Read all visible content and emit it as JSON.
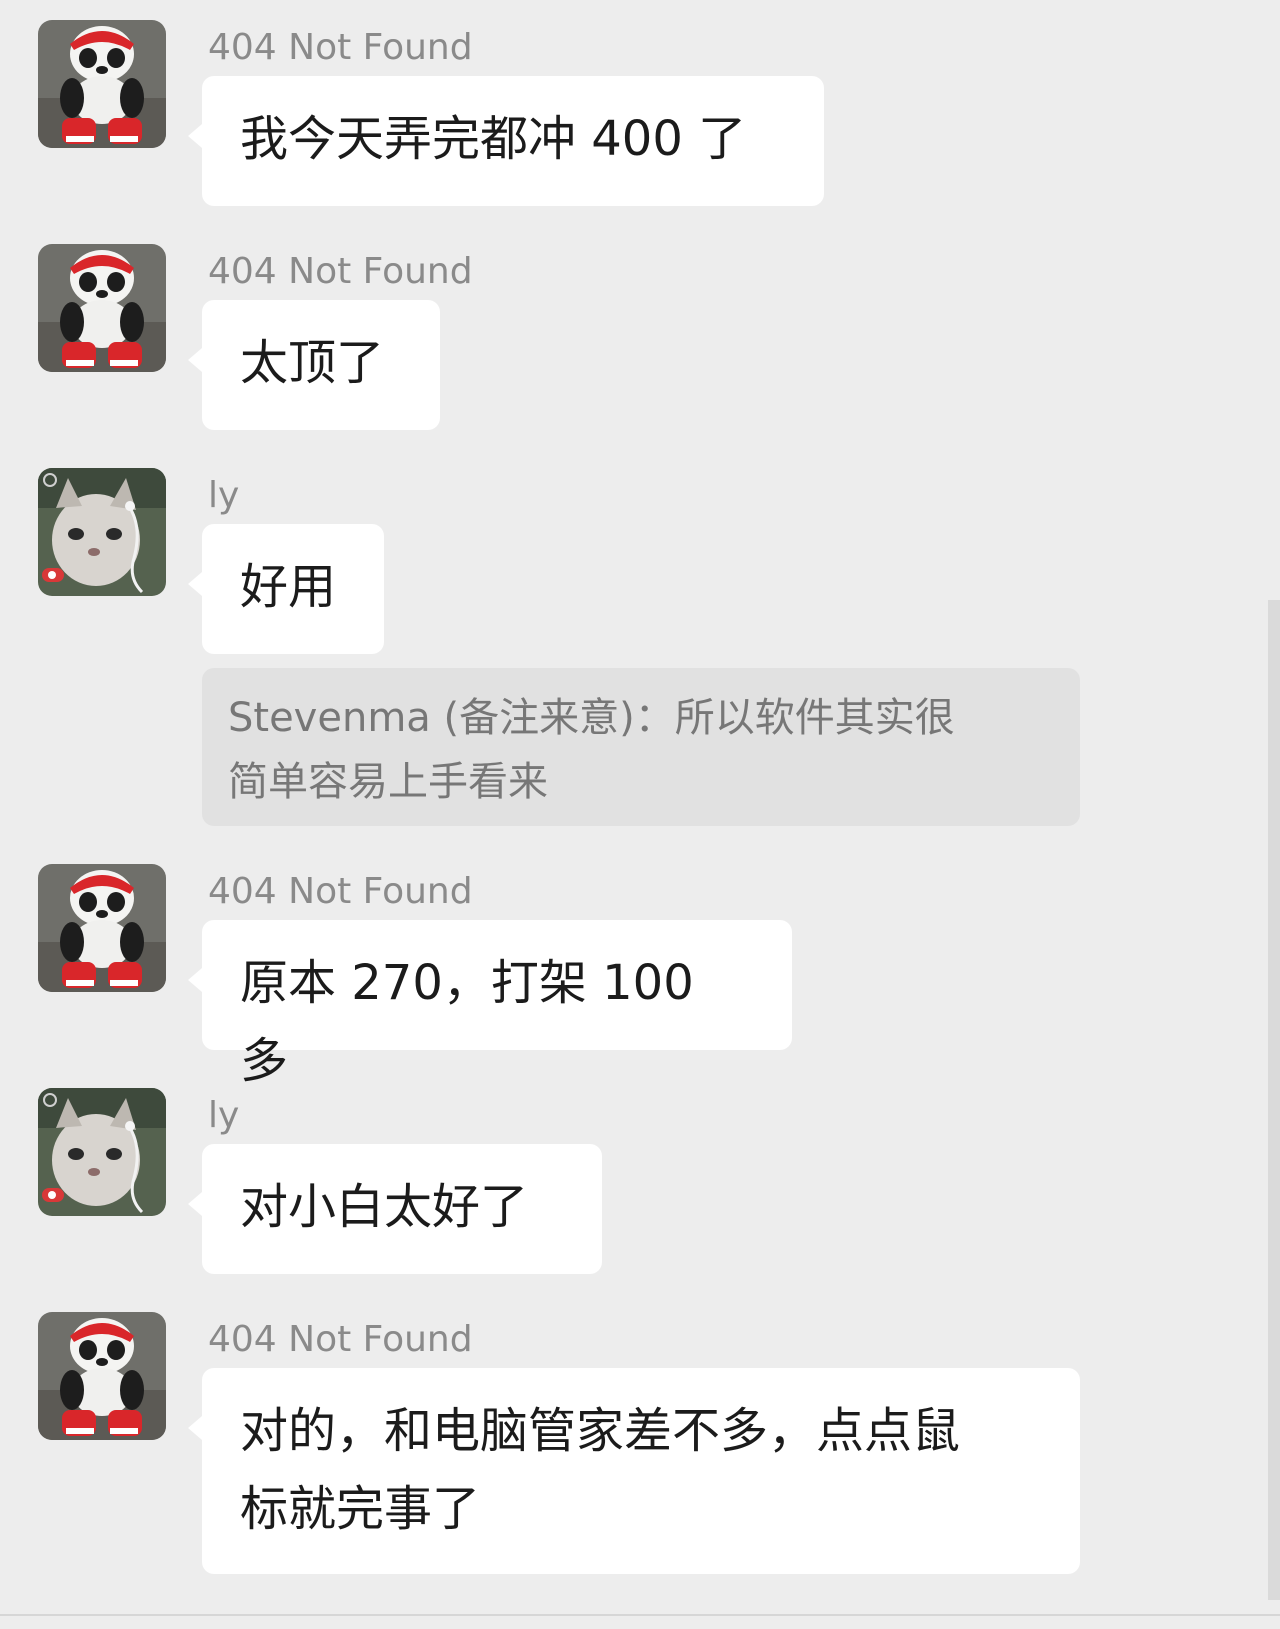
{
  "messages": [
    {
      "sender": "404 Not Found",
      "avatar": "panda-plush-avatar",
      "text": "我今天弄完都冲 400 了"
    },
    {
      "sender": "404 Not Found",
      "avatar": "panda-plush-avatar",
      "text": "太顶了"
    },
    {
      "sender": "ly",
      "avatar": "cat-avatar",
      "text": "好用"
    },
    {
      "sender": "404 Not Found",
      "avatar": "panda-plush-avatar",
      "text": "原本 270，打架 100 多"
    },
    {
      "sender": "ly",
      "avatar": "cat-avatar",
      "text": "对小白太好了"
    },
    {
      "sender": "404 Not Found",
      "avatar": "panda-plush-avatar",
      "text_line1": "对的，和电脑管家差不多，点点鼠",
      "text_line2": "标就完事了"
    }
  ],
  "quote": {
    "line1": "Stevenma (备注来意)：所以软件其实很",
    "line2": "简单容易上手看来"
  },
  "colors": {
    "background": "#ededed",
    "bubble": "#ffffff",
    "quote_background": "#e1e1e1",
    "sender_text": "#8a8a8a"
  }
}
